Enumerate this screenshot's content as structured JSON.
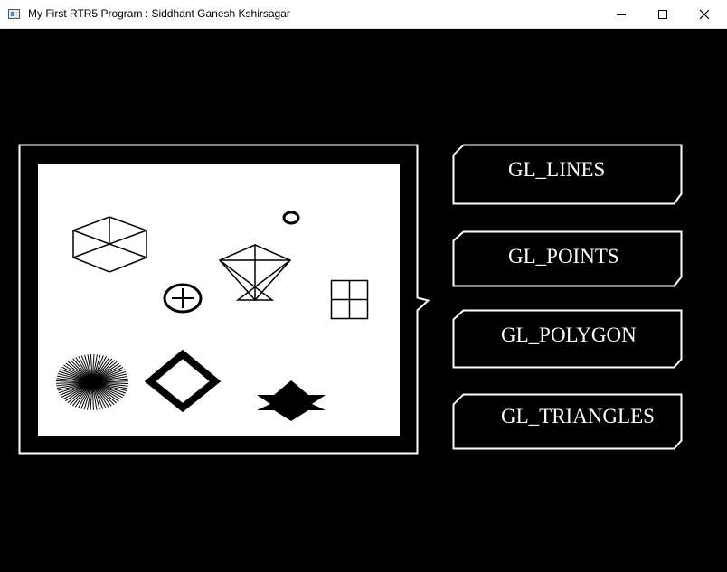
{
  "window": {
    "title": "My First RTR5 Program : Siddhant Ganesh Kshirsagar",
    "icon": "app-window-icon",
    "controls": [
      "minimize-icon",
      "maximize-icon",
      "close-icon"
    ],
    "background": "#000000",
    "foreground": "#ffffff"
  },
  "preview": {
    "shapes": [
      "cube",
      "small-ring",
      "kite",
      "circle-plus",
      "grid-square",
      "starburst",
      "thick-diamond",
      "star-polygon"
    ]
  },
  "buttons": [
    {
      "label": "GL_LINES"
    },
    {
      "label": "GL_POINTS"
    },
    {
      "label": "GL_POLYGON"
    },
    {
      "label": "GL_TRIANGLES"
    }
  ]
}
